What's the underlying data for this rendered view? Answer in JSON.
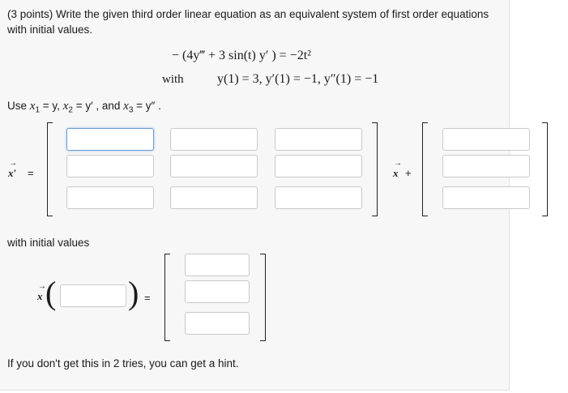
{
  "problem": {
    "points": "(3 points)",
    "prompt": "Write the given third order linear equation as an equivalent system of first order equations with initial values.",
    "equation": "− (4y‴ + 3 sin(t) y′ ) = −2t²",
    "with_label": "with",
    "initial_conditions": "y(1) = 3,  y′(1) = −1,  y″(1) = −1"
  },
  "substitution": {
    "use": "Use",
    "x1": "x",
    "x1_sub": "1",
    "eq_y": "= y,",
    "x2": "x",
    "x2_sub": "2",
    "eq_yp": "= y′ , and",
    "x3": "x",
    "x3_sub": "3",
    "eq_ypp": "= y″ ."
  },
  "system": {
    "lhs_symbol": "x",
    "prime": "′",
    "equals": "=",
    "plus": "+",
    "matrix": [
      [
        "",
        "",
        ""
      ],
      [
        "",
        "",
        ""
      ],
      [
        "",
        "",
        ""
      ]
    ],
    "forcing": [
      "",
      "",
      ""
    ]
  },
  "initial_section": {
    "label": "with initial values",
    "vector_symbol": "x",
    "argument": "",
    "equals": "=",
    "values": [
      "",
      "",
      ""
    ]
  },
  "hint_text": "If you don't get this in 2 tries, you can get a hint."
}
